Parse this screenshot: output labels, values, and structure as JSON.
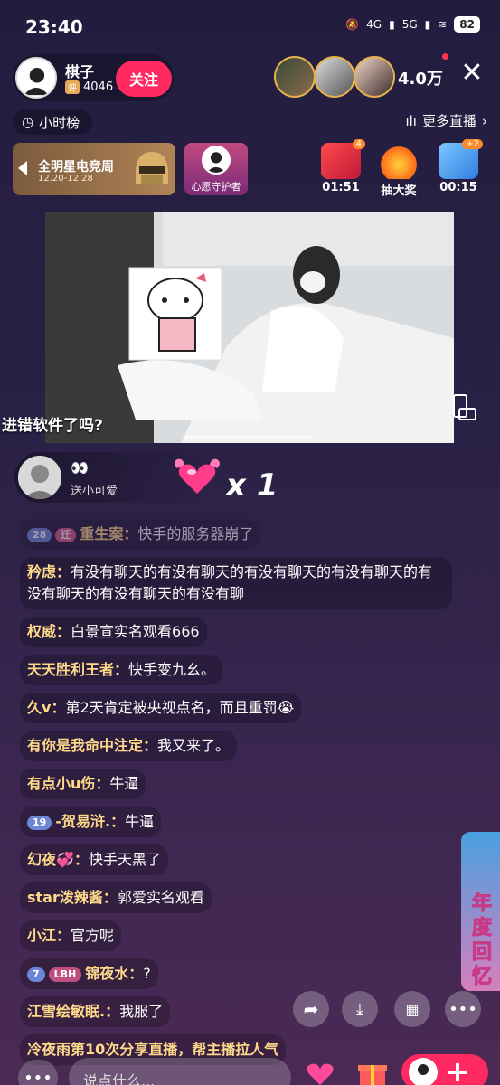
{
  "status_bar": {
    "time": "23:40",
    "network1": "4G",
    "network2": "5G",
    "battery": "82"
  },
  "anchor": {
    "name": "棋子",
    "badge": "评",
    "fans": "4046",
    "follow_label": "关注"
  },
  "viewers": {
    "count": "4.0万"
  },
  "hour_rank": {
    "label": "小时榜"
  },
  "more_live": {
    "label": "更多直播"
  },
  "event": {
    "title": "全明星电竞周",
    "dates": "12.20-12.28"
  },
  "guardian": {
    "label": "心愿守护者"
  },
  "activities": [
    {
      "label": "01:51",
      "badge": "4"
    },
    {
      "label": "抽大奖"
    },
    {
      "label": "00:15",
      "badge": "+2"
    }
  ],
  "video": {
    "caption": "进错软件了吗?"
  },
  "gift": {
    "user": "👀",
    "action": "送小可爱",
    "count": "x 1"
  },
  "chat": [
    {
      "badges": [
        "28",
        "迁"
      ],
      "name": "重生案",
      "text": "快手的服务器崩了",
      "faded": true
    },
    {
      "name": "矜虑",
      "text": "有没有聊天的有没有聊天的有没有聊天的有没有聊天的有没有聊天的有没有聊天的有没有聊"
    },
    {
      "name": "权威",
      "text": "白景宣实名观看666"
    },
    {
      "name": "天天胜利王者",
      "text": "快手变九幺。"
    },
    {
      "name": "久ⅴ",
      "text": "第2天肯定被央视点名，而且重罚😭"
    },
    {
      "name": "有你是我命中注定",
      "text": "我又来了。"
    },
    {
      "name": "有点小u伤",
      "text": "牛逼"
    },
    {
      "badges": [
        "19"
      ],
      "name": "-贺易浒.",
      "text": "牛逼"
    },
    {
      "name": "幻夜💞",
      "text": "快手天黑了"
    },
    {
      "name": "star泼辣酱",
      "text": "郭爱实名观看"
    },
    {
      "name": "小江",
      "text": "官方呢"
    },
    {
      "badges": [
        "7",
        "LBH"
      ],
      "name": "锦夜水",
      "text": "?"
    },
    {
      "name": "江雪绘敏眠.",
      "text": "我服了"
    },
    {
      "name": "冷夜雨第10次分享直播，帮主播拉人气",
      "text": "",
      "system": true
    }
  ],
  "side_banner": {
    "text": "年度回忆"
  },
  "bottom": {
    "input_placeholder": "说点什么..."
  },
  "colors": {
    "accent": "#ff2a5f",
    "name": "#ffd98a"
  }
}
